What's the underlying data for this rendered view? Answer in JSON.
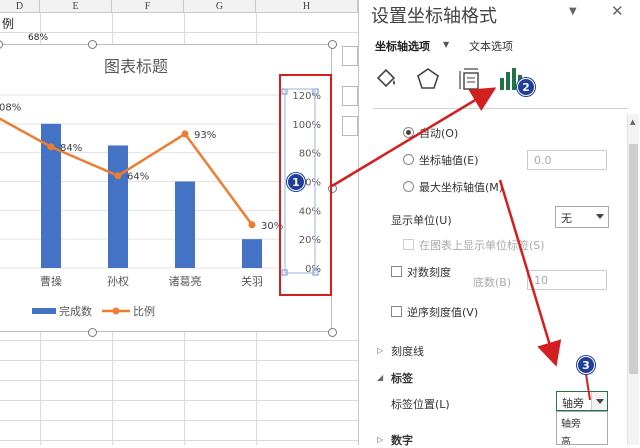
{
  "sheet": {
    "columns": [
      "D",
      "E",
      "F",
      "G",
      "H"
    ],
    "cell_text": "例",
    "cell_partial_value": "68%"
  },
  "chart_data": {
    "type": "bar",
    "title": "图表标题",
    "categories": [
      "曹操",
      "孙权",
      "诸葛亮",
      "关羽"
    ],
    "series": [
      {
        "name": "完成数",
        "type": "bar",
        "values": [
          100,
          85,
          60,
          20
        ]
      },
      {
        "name": "比例",
        "type": "line",
        "values": [
          0.84,
          0.64,
          0.93,
          0.3
        ],
        "labels": [
          "84%",
          "64%",
          "93%",
          "30%"
        ]
      }
    ],
    "left_clipped_label": "08%",
    "secondary_axis_ticks": [
      "120%",
      "100%",
      "80%",
      "60%",
      "40%",
      "20%",
      "0%"
    ],
    "ylim_secondary": [
      0,
      1.2
    ],
    "legend_position": "bottom",
    "colors": {
      "bar": "#4472c4",
      "line": "#ed7d31"
    }
  },
  "panel": {
    "title": "设置坐标轴格式",
    "tab_axis_options": "坐标轴选项",
    "tab_text_options": "文本选项",
    "icons": [
      "paint-bucket-icon",
      "pentagon-icon",
      "size-properties-icon",
      "bar-chart-icon"
    ],
    "auto_label": "自动(O)",
    "axis_value_label": "坐标轴值(E)",
    "axis_value_input": "0.0",
    "max_axis_value_label": "最大坐标轴值(M)",
    "display_units_label": "显示单位(U)",
    "display_units_value": "无",
    "show_units_label": "在图表上显示单位标签(S)",
    "log_scale_label": "对数刻度",
    "base_label": "底数(B)",
    "base_value": "10",
    "reverse_label": "逆序刻度值(V)",
    "tick_marks_section": "刻度线",
    "labels_section": "标签",
    "label_position_label": "标签位置(L)",
    "label_position_value": "轴旁",
    "dropdown_option": "轴旁",
    "dropdown_option_2": "高",
    "number_section": "数字"
  },
  "annotations": {
    "badge1": "1",
    "badge2": "2",
    "badge3": "3"
  }
}
